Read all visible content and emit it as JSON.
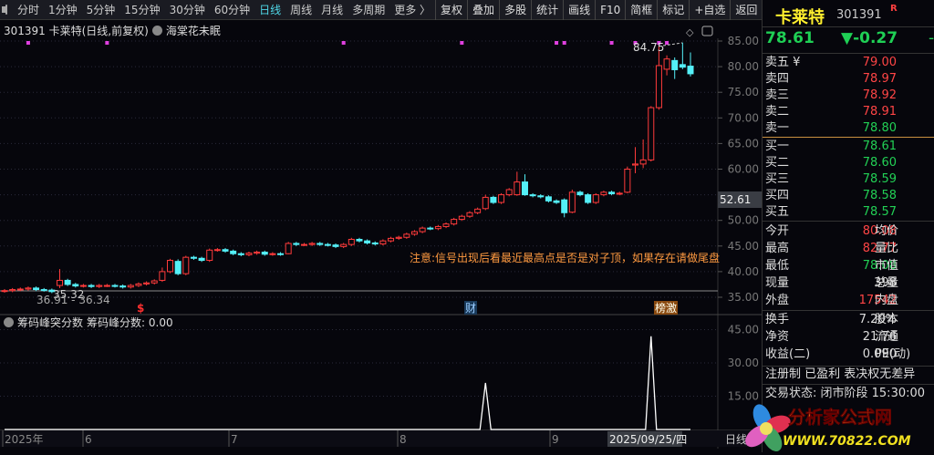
{
  "toolbar": {
    "tabs": [
      "分时",
      "1分钟",
      "5分钟",
      "15分钟",
      "30分钟",
      "60分钟",
      "日线",
      "周线",
      "月线",
      "多周期",
      "更多 〉"
    ],
    "active_tab": "日线",
    "buttons": [
      "复权",
      "叠加",
      "多股",
      "统计",
      "画线",
      "F10",
      "简框",
      "标记",
      "+自选",
      "返回"
    ]
  },
  "info": {
    "title": "301391 卡莱特(日线,前复权)",
    "indicator": "海棠花未眠"
  },
  "main_chart": {
    "price_axis": [
      "85.00",
      "80.00",
      "75.00",
      "70.00",
      "65.00",
      "60.00",
      "50.00",
      "45.00",
      "40.00",
      "35.00"
    ],
    "crosshair_price": "52.61",
    "high_label": "84.75",
    "low_label_1": "35.32",
    "low_label_2": "36.91 - 36.34",
    "note": "注意:信号出现后看最近最高点是否是对子顶，如果存在请做尾盘",
    "markers": {
      "dollar": "$",
      "cai": "财",
      "bang": "榜",
      "ji": "激"
    },
    "colors": {
      "up": "#ff3b3b",
      "down": "#54f0f8",
      "dots": "#e040e0"
    },
    "closes": [
      36.3,
      36.5,
      36.6,
      36.8,
      36.5,
      36.4,
      36.1,
      38.3,
      37.5,
      37.2,
      37.3,
      37.1,
      37.3,
      37.3,
      37.2,
      37.0,
      37.3,
      37.6,
      37.8,
      38.2,
      40.0,
      42.2,
      39.6,
      42.8,
      42.6,
      42.2,
      44.2,
      44.3,
      44.0,
      43.5,
      43.3,
      43.6,
      43.8,
      43.4,
      43.5,
      43.4,
      45.5,
      45.3,
      45.3,
      45.5,
      45.3,
      45.2,
      44.9,
      45.3,
      46.3,
      46.0,
      45.6,
      45.4,
      46.0,
      46.5,
      46.7,
      47.3,
      47.8,
      48.5,
      48.4,
      48.8,
      49.3,
      50.2,
      50.8,
      51.5,
      52.2,
      54.5,
      53.5,
      55.0,
      56.0,
      57.5,
      55.0,
      54.8,
      54.6,
      53.8,
      53.5,
      51.5,
      55.5,
      55.0,
      53.5,
      55.0,
      55.5,
      55.2,
      55.3,
      60.0,
      61.0,
      61.8,
      72.0,
      80.2,
      81.5,
      79.5,
      79.9,
      78.61
    ],
    "overrides": {
      "7": [
        37.3,
        38.3,
        40.5,
        36.8
      ],
      "20": [
        38.3,
        40.0,
        40.8,
        38.0
      ],
      "22": [
        42.0,
        39.6,
        42.4,
        39.3
      ],
      "36": [
        43.5,
        45.5,
        45.8,
        43.4
      ],
      "61": [
        52.3,
        54.5,
        55.0,
        52.0
      ],
      "65": [
        55.0,
        57.5,
        59.5,
        54.8
      ],
      "66": [
        57.5,
        55.0,
        59.0,
        54.8
      ],
      "71": [
        54.0,
        51.5,
        54.3,
        50.6
      ],
      "72": [
        51.6,
        55.5,
        56.0,
        51.4
      ],
      "79": [
        55.5,
        60.0,
        60.5,
        55.3
      ],
      "80": [
        60.8,
        61.0,
        64.3,
        59.2
      ],
      "81": [
        61.0,
        61.8,
        65.8,
        60.2
      ],
      "82": [
        61.8,
        72.0,
        72.3,
        61.5
      ],
      "83": [
        72.0,
        80.2,
        84.75,
        71.6
      ],
      "84": [
        79.5,
        81.5,
        82.2,
        78.3
      ],
      "85": [
        81.2,
        79.4,
        81.8,
        77.6
      ],
      "86": [
        80.4,
        79.9,
        84.7,
        79.5
      ],
      "87": [
        80.1,
        78.61,
        82.77,
        78.08
      ]
    },
    "dot_positions_candle_index": [
      3,
      13,
      43,
      58,
      70,
      71,
      77,
      80,
      83,
      84
    ]
  },
  "sub_chart": {
    "title": "筹码峰突分数",
    "value_label": "筹码峰分数: 0.00",
    "axis": [
      "45.00",
      "30.00",
      "15.00"
    ],
    "values_peaks": [
      {
        "index": 61,
        "value": 21
      },
      {
        "index": 82,
        "value": 42
      }
    ]
  },
  "date_axis": {
    "labels": [
      "2025年",
      "6",
      "7",
      "8",
      "9"
    ],
    "current": "2025/09/25/四",
    "period": "日线"
  },
  "quote": {
    "name": "卡莱特",
    "code": "301391",
    "flag": "R",
    "price": "78.61",
    "change": "▼-0.27",
    "cut": "-",
    "asks": [
      {
        "label": "卖五 ¥",
        "price": "79.00"
      },
      {
        "label": "卖四",
        "price": "78.97"
      },
      {
        "label": "卖三",
        "price": "78.92"
      },
      {
        "label": "卖二",
        "price": "78.91"
      },
      {
        "label": "卖一",
        "price": "78.80"
      }
    ],
    "bids": [
      {
        "label": "买一",
        "price": "78.61"
      },
      {
        "label": "买二",
        "price": "78.60"
      },
      {
        "label": "买三",
        "price": "78.59"
      },
      {
        "label": "买四",
        "price": "78.58"
      },
      {
        "label": "买五",
        "price": "78.57"
      }
    ],
    "stats": [
      {
        "label": "今开",
        "value": "80.08",
        "label2": "均价"
      },
      {
        "label": "最高",
        "value": "82.77",
        "label2": "量比"
      },
      {
        "label": "最低",
        "value": "78.08",
        "label2": "市值"
      },
      {
        "label": "现量",
        "value": "398",
        "label2": "总量"
      },
      {
        "label": "外盘",
        "value": "17542",
        "label2": "内盘"
      }
    ],
    "stats2": [
      {
        "label": "换手",
        "value": "7.20%",
        "label2": "股本"
      },
      {
        "label": "净资",
        "value": "21.76",
        "label2": "流通"
      },
      {
        "label": "收益(二)",
        "value": "0.090",
        "label2": "PE(动)"
      }
    ],
    "tags": "注册制 已盈利 表决权无差异",
    "status": "交易状态: 闭市阶段 15:30:00"
  },
  "watermark": {
    "name": "分析家公式网",
    "url": "WWW.70822.COM"
  }
}
